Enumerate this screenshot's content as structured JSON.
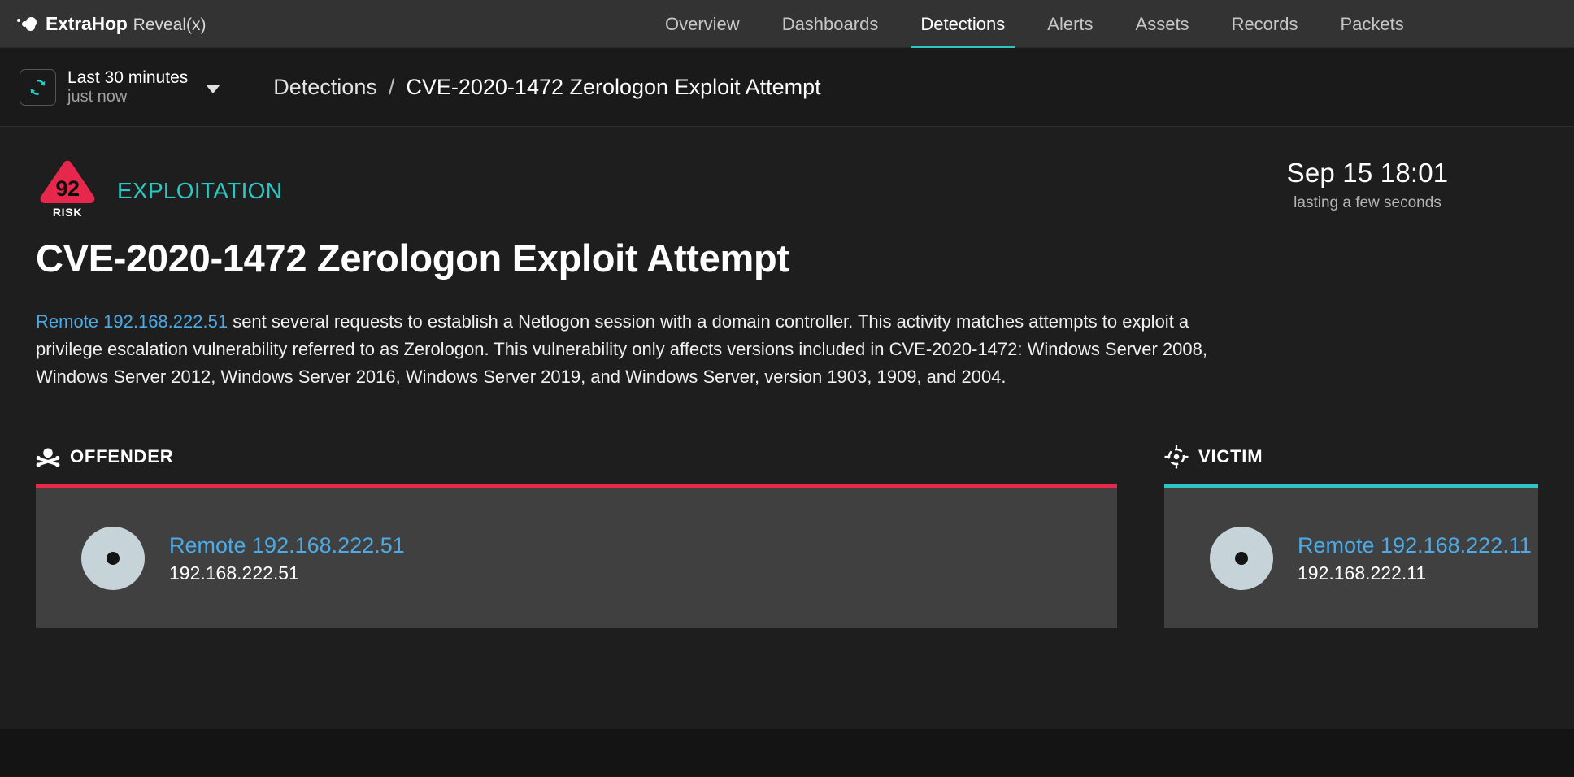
{
  "brand": {
    "name": "ExtraHop",
    "product": "Reveal(x)",
    "logo_icon": "extrahop-dots-logo"
  },
  "colors": {
    "accent_teal": "#2dc7c3",
    "risk_red": "#e8274d",
    "link_blue": "#4eaae4",
    "nav_bg": "#333333",
    "body_bg": "#1e1e1e",
    "card_bg": "#404040"
  },
  "nav": {
    "items": [
      {
        "label": "Overview",
        "active": false
      },
      {
        "label": "Dashboards",
        "active": false
      },
      {
        "label": "Detections",
        "active": true
      },
      {
        "label": "Alerts",
        "active": false
      },
      {
        "label": "Assets",
        "active": false
      },
      {
        "label": "Records",
        "active": false
      },
      {
        "label": "Packets",
        "active": false
      }
    ]
  },
  "subheader": {
    "refresh_icon": "refresh-icon",
    "timeframe": "Last 30 minutes",
    "timeframe_updated": "just now",
    "dropdown_icon": "chevron-down-icon",
    "breadcrumb": {
      "parent": "Detections",
      "separator": "/",
      "current": "CVE-2020-1472 Zerologon Exploit Attempt"
    }
  },
  "detection": {
    "risk_score": "92",
    "risk_label": "RISK",
    "category": "EXPLOITATION",
    "timestamp": "Sep 15 18:01",
    "duration": "lasting a few seconds",
    "title": "CVE-2020-1472 Zerologon Exploit Attempt",
    "description_link": "Remote 192.168.222.51",
    "description_rest": " sent several requests to establish a Netlogon session with a domain controller. This activity matches attempts to exploit a privilege escalation vulnerability referred to as Zerologon. This vulnerability only affects versions included in CVE-2020-1472: Windows Server 2008, Windows Server 2012, Windows Server 2016, Windows Server 2019, and Windows Server, version 1903, 1909, and 2004."
  },
  "participants": {
    "offender": {
      "heading": "OFFENDER",
      "icon": "skull-crossbones-icon",
      "device_name": "Remote 192.168.222.51",
      "device_ip": "192.168.222.51"
    },
    "victim": {
      "heading": "VICTIM",
      "icon": "crosshair-target-icon",
      "device_name": "Remote 192.168.222.11",
      "device_ip": "192.168.222.11"
    }
  }
}
